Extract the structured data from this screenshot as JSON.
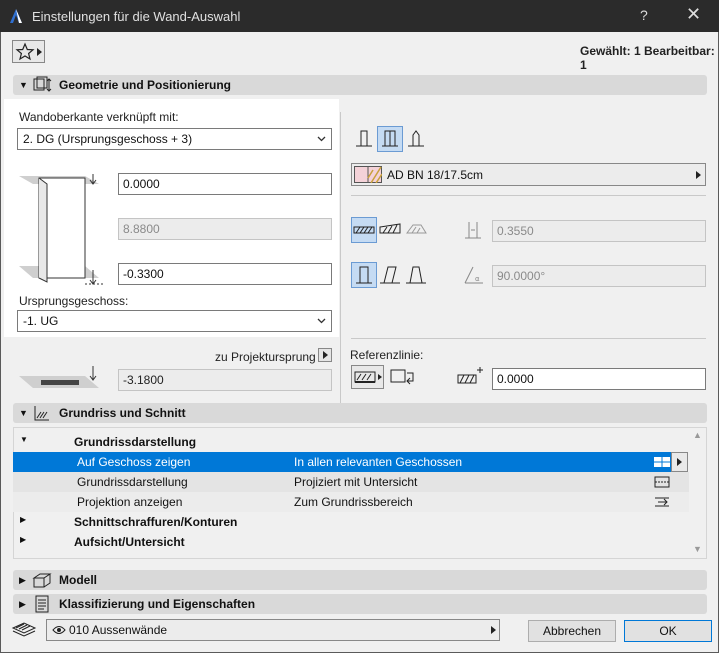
{
  "window": {
    "title": "Einstellungen für die Wand-Auswahl",
    "help": "?",
    "close": "✕"
  },
  "header": {
    "selection_info": "Gewählt: 1 Bearbeitbar: 1"
  },
  "geometry": {
    "title": "Geometrie und Positionierung",
    "top_link_label": "Wandoberkante verknüpft mit:",
    "top_link_value": "2. DG (Ursprungsgeschoss + 3)",
    "top_offset": "0.0000",
    "height": "8.8800",
    "bottom_offset": "-0.3300",
    "home_story_label": "Ursprungsgeschoss:",
    "home_story_value": "-1. UG",
    "project_zero_label": "zu Projektursprung",
    "project_zero_value": "-3.1800",
    "building_material": "AD BN 18/17.5cm",
    "thickness": "0.3550",
    "angle": "90.0000°",
    "ref_line_label": "Referenzlinie:",
    "ref_offset": "0.0000"
  },
  "floorplan": {
    "title": "Grundriss und Schnitt",
    "group1": "Grundrissdarstellung",
    "rows": [
      {
        "name": "Auf Geschoss zeigen",
        "value": "In allen relevanten Geschossen"
      },
      {
        "name": "Grundrissdarstellung",
        "value": "Projiziert mit Untersicht"
      },
      {
        "name": "Projektion anzeigen",
        "value": "Zum Grundrissbereich"
      }
    ],
    "group2": "Schnittschraffuren/Konturen",
    "group3": "Aufsicht/Untersicht"
  },
  "model": {
    "title": "Modell"
  },
  "classification": {
    "title": "Klassifizierung und Eigenschaften"
  },
  "footer": {
    "layer": "010 Aussenwände",
    "cancel": "Abbrechen",
    "ok": "OK"
  },
  "colors": {
    "titlebar": "#2b2b2b",
    "selection": "#0078d7",
    "section_header": "#d9d9d9"
  }
}
